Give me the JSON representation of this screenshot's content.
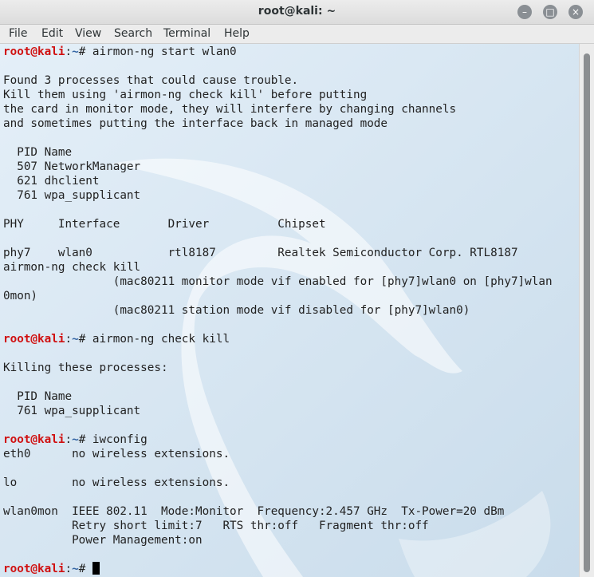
{
  "window": {
    "title": "root@kali: ~"
  },
  "menu": [
    "File",
    "Edit",
    "View",
    "Search",
    "Terminal",
    "Help"
  ],
  "prompt": {
    "host": "root@kali",
    "sep": ":",
    "cwd": "~",
    "sym": "# "
  },
  "lines": [
    {
      "prompt": true,
      "cmd": "airmon-ng start wlan0"
    },
    {
      "text": ""
    },
    {
      "text": "Found 3 processes that could cause trouble."
    },
    {
      "text": "Kill them using 'airmon-ng check kill' before putting"
    },
    {
      "text": "the card in monitor mode, they will interfere by changing channels"
    },
    {
      "text": "and sometimes putting the interface back in managed mode"
    },
    {
      "text": ""
    },
    {
      "text": "  PID Name"
    },
    {
      "text": "  507 NetworkManager"
    },
    {
      "text": "  621 dhclient"
    },
    {
      "text": "  761 wpa_supplicant"
    },
    {
      "text": ""
    },
    {
      "text": "PHY     Interface       Driver          Chipset"
    },
    {
      "text": ""
    },
    {
      "text": "phy7    wlan0           rtl8187         Realtek Semiconductor Corp. RTL8187"
    },
    {
      "text": "airmon-ng check kill"
    },
    {
      "text": "                (mac80211 monitor mode vif enabled for [phy7]wlan0 on [phy7]wlan"
    },
    {
      "text": "0mon)"
    },
    {
      "text": "                (mac80211 station mode vif disabled for [phy7]wlan0)"
    },
    {
      "text": ""
    },
    {
      "prompt": true,
      "cmd": "airmon-ng check kill"
    },
    {
      "text": ""
    },
    {
      "text": "Killing these processes:"
    },
    {
      "text": ""
    },
    {
      "text": "  PID Name"
    },
    {
      "text": "  761 wpa_supplicant"
    },
    {
      "text": ""
    },
    {
      "prompt": true,
      "cmd": "iwconfig"
    },
    {
      "text": "eth0      no wireless extensions."
    },
    {
      "text": ""
    },
    {
      "text": "lo        no wireless extensions."
    },
    {
      "text": ""
    },
    {
      "text": "wlan0mon  IEEE 802.11  Mode:Monitor  Frequency:2.457 GHz  Tx-Power=20 dBm"
    },
    {
      "text": "          Retry short limit:7   RTS thr:off   Fragment thr:off"
    },
    {
      "text": "          Power Management:on"
    },
    {
      "text": ""
    },
    {
      "prompt": true,
      "cmd": "",
      "cursor": true
    }
  ],
  "colors": {
    "host": "#d01010",
    "cwd": "#3465a4",
    "terminal_bg": "#dbe9f5"
  }
}
